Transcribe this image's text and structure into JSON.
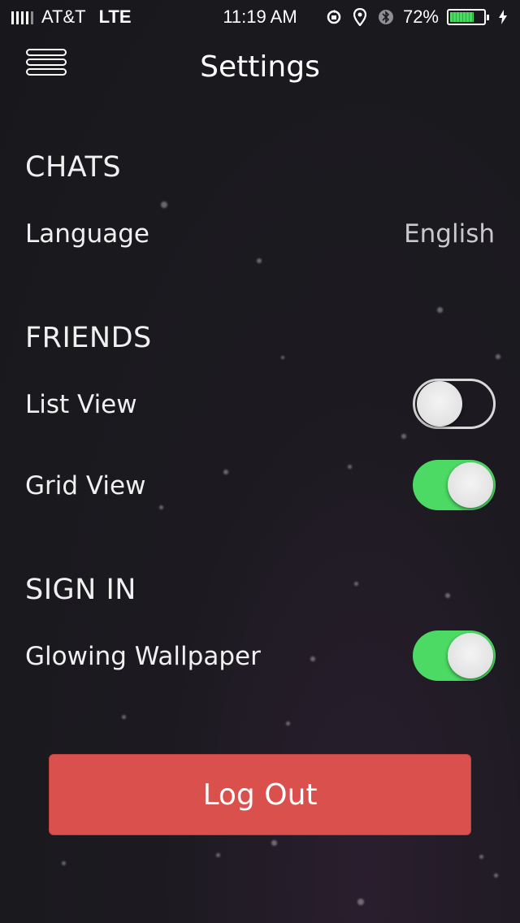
{
  "status_bar": {
    "carrier": "AT&T",
    "network": "LTE",
    "time": "11:19 AM",
    "battery_percent": "72%",
    "battery_level": 0.72,
    "icons": [
      "signal-icon",
      "rotation-lock-icon",
      "location-icon",
      "bluetooth-icon",
      "battery-icon",
      "charging-icon"
    ]
  },
  "header": {
    "title": "Settings",
    "menu_icon": "hamburger-menu-icon"
  },
  "sections": {
    "chats": {
      "heading": "CHATS",
      "language_label": "Language",
      "language_value": "English"
    },
    "friends": {
      "heading": "FRIENDS",
      "list_view_label": "List View",
      "list_view_on": false,
      "grid_view_label": "Grid View",
      "grid_view_on": true
    },
    "sign_in": {
      "heading": "SIGN IN",
      "glowing_wallpaper_label": "Glowing Wallpaper",
      "glowing_wallpaper_on": true
    }
  },
  "logout": {
    "label": "Log Out"
  },
  "colors": {
    "background": "#1c1a20",
    "toggle_on": "#4cd964",
    "logout_button": "#d9504c",
    "text": "#f2f2f2",
    "secondary_text": "#c9c9cc"
  }
}
